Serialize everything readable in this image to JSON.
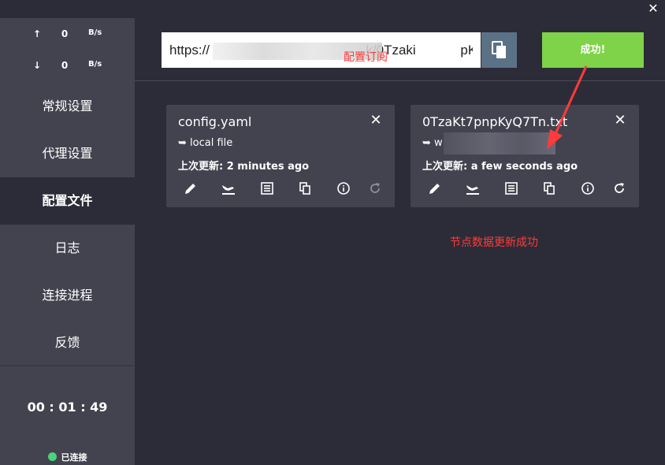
{
  "window": {
    "close_glyph": "✕"
  },
  "speed": {
    "up": {
      "arrow": "↑",
      "value": "0",
      "unit": "B/s"
    },
    "down": {
      "arrow": "↓",
      "value": "0",
      "unit": "B/s"
    }
  },
  "nav": [
    "常规设置",
    "代理设置",
    "配置文件",
    "日志",
    "连接进程",
    "反馈"
  ],
  "nav_active": "配置文件",
  "timer": "00 : 01 : 49",
  "status": {
    "label": "已连接",
    "color": "#4bd37a"
  },
  "subscribe": {
    "url": "https://                                          k/0Tzaki            pK",
    "success_label": "成功!"
  },
  "annotations": {
    "subscribe_label": "配置订阅",
    "update_success": "节点数据更新成功",
    "color": "#ff3b3b"
  },
  "profiles": [
    {
      "name": "config.yaml",
      "source": "➥ local file",
      "updated": "上次更新: 2 minutes ago",
      "refresh_enabled": false
    },
    {
      "name": "0TzaKt7pnpKyQ7Tn.txt",
      "source": "➥ w",
      "updated": "上次更新: a few seconds ago",
      "refresh_enabled": true
    }
  ],
  "colors": {
    "sidebar": "#434350",
    "background": "#2c2c38",
    "success": "#7ed348",
    "paste": "#5b7286"
  },
  "icons": [
    "edit-icon",
    "plane-icon",
    "list-icon",
    "copy-icon",
    "info-icon",
    "refresh-icon"
  ]
}
